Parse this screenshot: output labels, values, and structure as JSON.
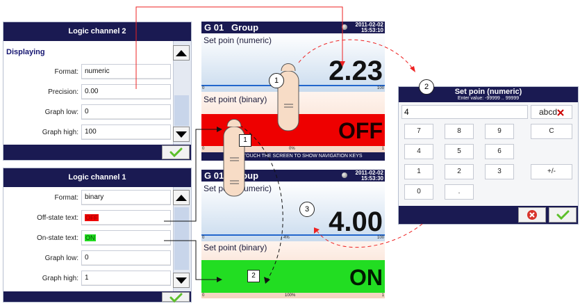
{
  "logic2": {
    "title": "Logic channel 2",
    "section": "Displaying",
    "rows": [
      {
        "label": "Format:",
        "value": "numeric"
      },
      {
        "label": "Precision:",
        "value": "0.00"
      },
      {
        "label": "Graph low:",
        "value": "0"
      },
      {
        "label": "Graph high:",
        "value": "100"
      }
    ]
  },
  "logic1": {
    "title": "Logic channel 1",
    "rows": [
      {
        "label": "Format:",
        "value": "binary"
      },
      {
        "label": "Off-state text:",
        "value": "OFF"
      },
      {
        "label": "On-state text:",
        "value": "ON"
      },
      {
        "label": "Graph low:",
        "value": "0"
      },
      {
        "label": "Graph high:",
        "value": "1"
      }
    ]
  },
  "screen_top": {
    "title": "G 01   Group",
    "date": "2011-02-02",
    "time": "15:53:10",
    "tile1": {
      "label": "Set poin (numeric)",
      "value": "2.23",
      "scale_min": "0",
      "scale_max": "100"
    },
    "tile2": {
      "label": "Set point (binary)",
      "value": "OFF",
      "scale_min": "0",
      "scale_mid": "0%",
      "scale_max": "1"
    },
    "hint": "TOUCH THE SCREEN TO SHOW NAVIGATION KEYS"
  },
  "screen_bottom": {
    "title": "G 01   Group",
    "date": "2011-02-02",
    "time": "15:53:30",
    "tile1": {
      "label": "Set poin (numeric)",
      "value": "4.00",
      "scale_min": "0",
      "scale_mid": "4%",
      "scale_max": "100"
    },
    "tile2": {
      "label": "Set point (binary)",
      "value": "ON",
      "scale_min": "0",
      "scale_mid": "100%",
      "scale_max": "1"
    }
  },
  "keypad": {
    "title": "Set poin (numeric)",
    "subtitle": "Enter value: -99999 .. 99999",
    "input": "4",
    "mode_key": "abcd",
    "keys": [
      "7",
      "8",
      "9",
      "C",
      "4",
      "5",
      "6",
      "1",
      "2",
      "3",
      "+/-",
      "0",
      "."
    ]
  },
  "callouts": {
    "c1": "1",
    "c2": "2",
    "c3": "3",
    "s1": "1",
    "s2": "2"
  },
  "colors": {
    "navy": "#1a1a52",
    "off_red": "#ee0000",
    "on_green": "#22dd22",
    "annot_red": "#ee2222"
  }
}
